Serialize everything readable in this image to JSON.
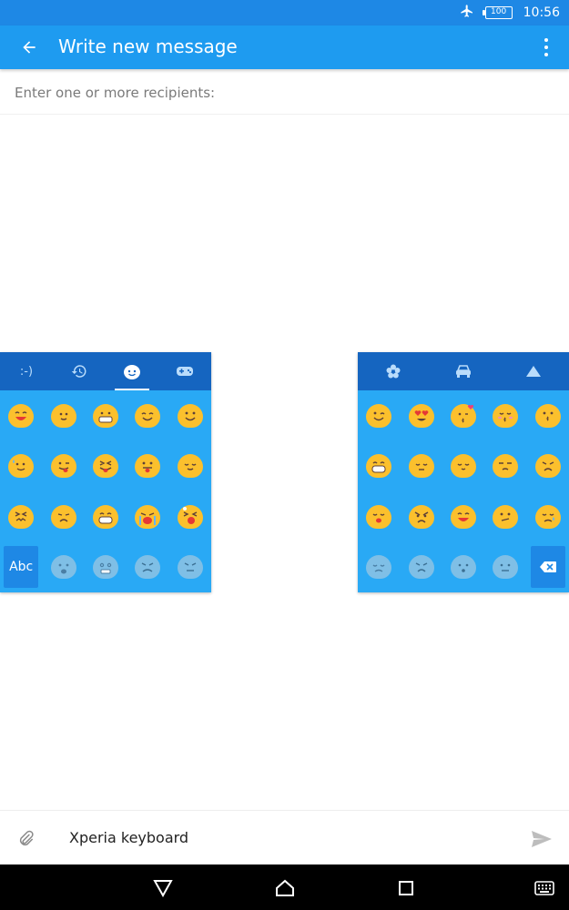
{
  "status_bar": {
    "battery": "100",
    "time": "10:56",
    "icons": [
      "airplane-mode-icon",
      "battery-icon"
    ]
  },
  "app_bar": {
    "title": "Write new message",
    "back_icon": "arrow-back-icon",
    "menu_icon": "more-vert-icon"
  },
  "recipients": {
    "placeholder": "Enter one or more recipients:"
  },
  "keyboard_left": {
    "tabs": [
      {
        "label": ":-)",
        "name": "emoticon-text"
      },
      {
        "label": "",
        "name": "recent-history-icon"
      },
      {
        "label": "",
        "name": "smiley-category-icon"
      },
      {
        "label": "",
        "name": "gamepad-category-icon"
      }
    ],
    "active_tab": 2,
    "abc_label": "Abc"
  },
  "keyboard_right": {
    "tabs": [
      {
        "label": "",
        "name": "flower-category-icon"
      },
      {
        "label": "",
        "name": "car-category-icon"
      },
      {
        "label": "",
        "name": "triangle-symbols-category-icon"
      }
    ],
    "delete_icon": "backspace-icon"
  },
  "compose": {
    "text": "Xperia keyboard",
    "attach_icon": "paperclip-icon",
    "send_icon": "send-icon"
  },
  "nav_bar": {
    "icons": [
      "back-triangle-icon",
      "home-icon",
      "recents-icon",
      "keyboard-icon"
    ]
  },
  "colors": {
    "primary": "#1e9bf0",
    "status": "#1e88e5",
    "keyboard_bg": "#29a9f5",
    "keyboard_tabs": "#1565c0",
    "emoji": "#fbc02d"
  }
}
